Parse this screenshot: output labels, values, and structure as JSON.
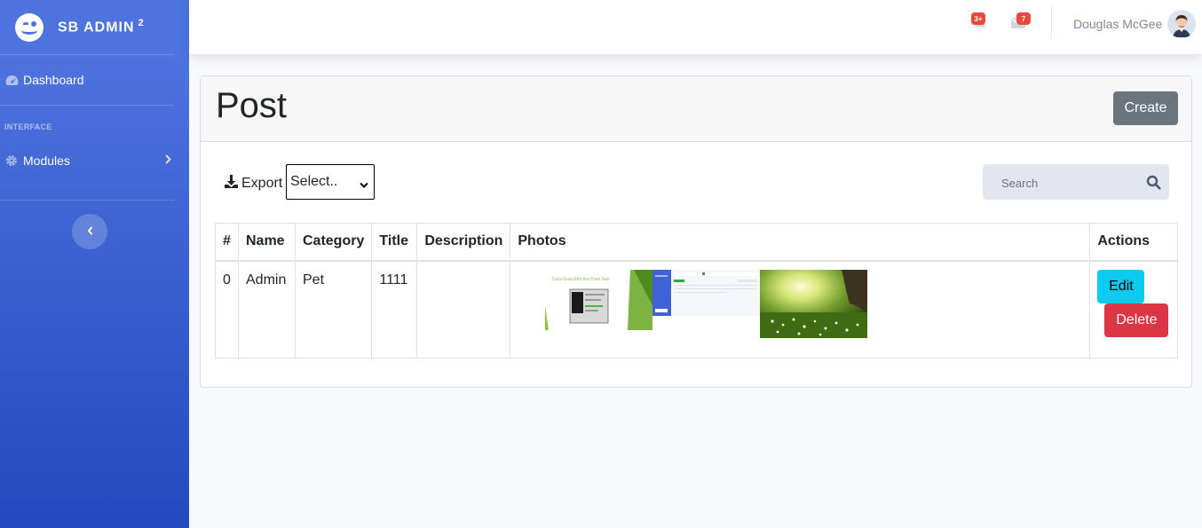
{
  "brand": {
    "name": "SB ADMIN",
    "sup": "2"
  },
  "sidebar": {
    "items": [
      {
        "label": "Dashboard",
        "icon": "tachometer-icon"
      },
      {
        "label": "Modules",
        "icon": "gear-icon"
      }
    ],
    "heading": "INTERFACE"
  },
  "topbar": {
    "alerts_badge": "3+",
    "messages_badge": "7",
    "user_name": "Douglas McGee"
  },
  "page": {
    "title": "Post",
    "create_label": "Create",
    "export_label": "Export",
    "select_value": "Select..",
    "search_placeholder": "Search"
  },
  "table": {
    "headers": [
      "#",
      "Name",
      "Category",
      "Title",
      "Description",
      "Photos",
      "Actions"
    ],
    "rows": [
      {
        "num": "0",
        "name": "Admin",
        "category": "Pet",
        "title": "1111",
        "description": "",
        "photos_text": "Cara Guía Efectiva Para Sus"
      }
    ],
    "edit_label": "Edit",
    "delete_label": "Delete"
  },
  "colors": {
    "sidebar_start": "#4e73df",
    "sidebar_end": "#224abe",
    "badge": "#e74a3b",
    "create_button": "#6c757d",
    "edit_button": "#0dcaf0",
    "delete_button": "#dc3545"
  }
}
